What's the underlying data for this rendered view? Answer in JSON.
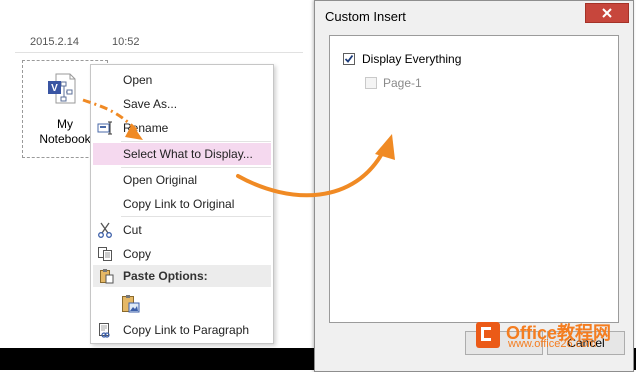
{
  "note": {
    "date": "2015.2.14",
    "time": "10:52"
  },
  "attachment": {
    "label": "My\nNotebook",
    "icon": "visio-file-icon"
  },
  "context_menu": {
    "items": [
      {
        "label": "Open",
        "icon": null
      },
      {
        "label": "Save As...",
        "icon": null
      },
      {
        "label": "Rename",
        "icon": "rename-icon"
      },
      {
        "label": "Select What to Display...",
        "icon": null,
        "highlighted": true
      },
      {
        "label": "Open Original",
        "icon": null
      },
      {
        "label": "Copy Link to Original",
        "icon": null
      },
      {
        "label": "Cut",
        "icon": "scissors-icon"
      },
      {
        "label": "Copy",
        "icon": "copy-icon"
      },
      {
        "label": "Paste Options:",
        "icon": "paste-icon",
        "header": true
      },
      {
        "label": "",
        "icon": "paste-picture-icon"
      },
      {
        "label": "Copy Link to Paragraph",
        "icon": "link-paragraph-icon"
      }
    ],
    "highlight_color": "#f5d9ef"
  },
  "dialog": {
    "title": "Custom Insert",
    "tree": [
      {
        "label": "Display Everything",
        "checked": true,
        "enabled": true
      },
      {
        "label": "Page-1",
        "checked": false,
        "enabled": false
      }
    ],
    "buttons": {
      "ok": "",
      "cancel": "Cancel"
    }
  },
  "watermark": {
    "line1": "Office教程网",
    "line2": "www.office26.com"
  },
  "colors": {
    "arrow": "#f08a24",
    "close_button": "#c7463c",
    "watermark": "#f47d20"
  }
}
